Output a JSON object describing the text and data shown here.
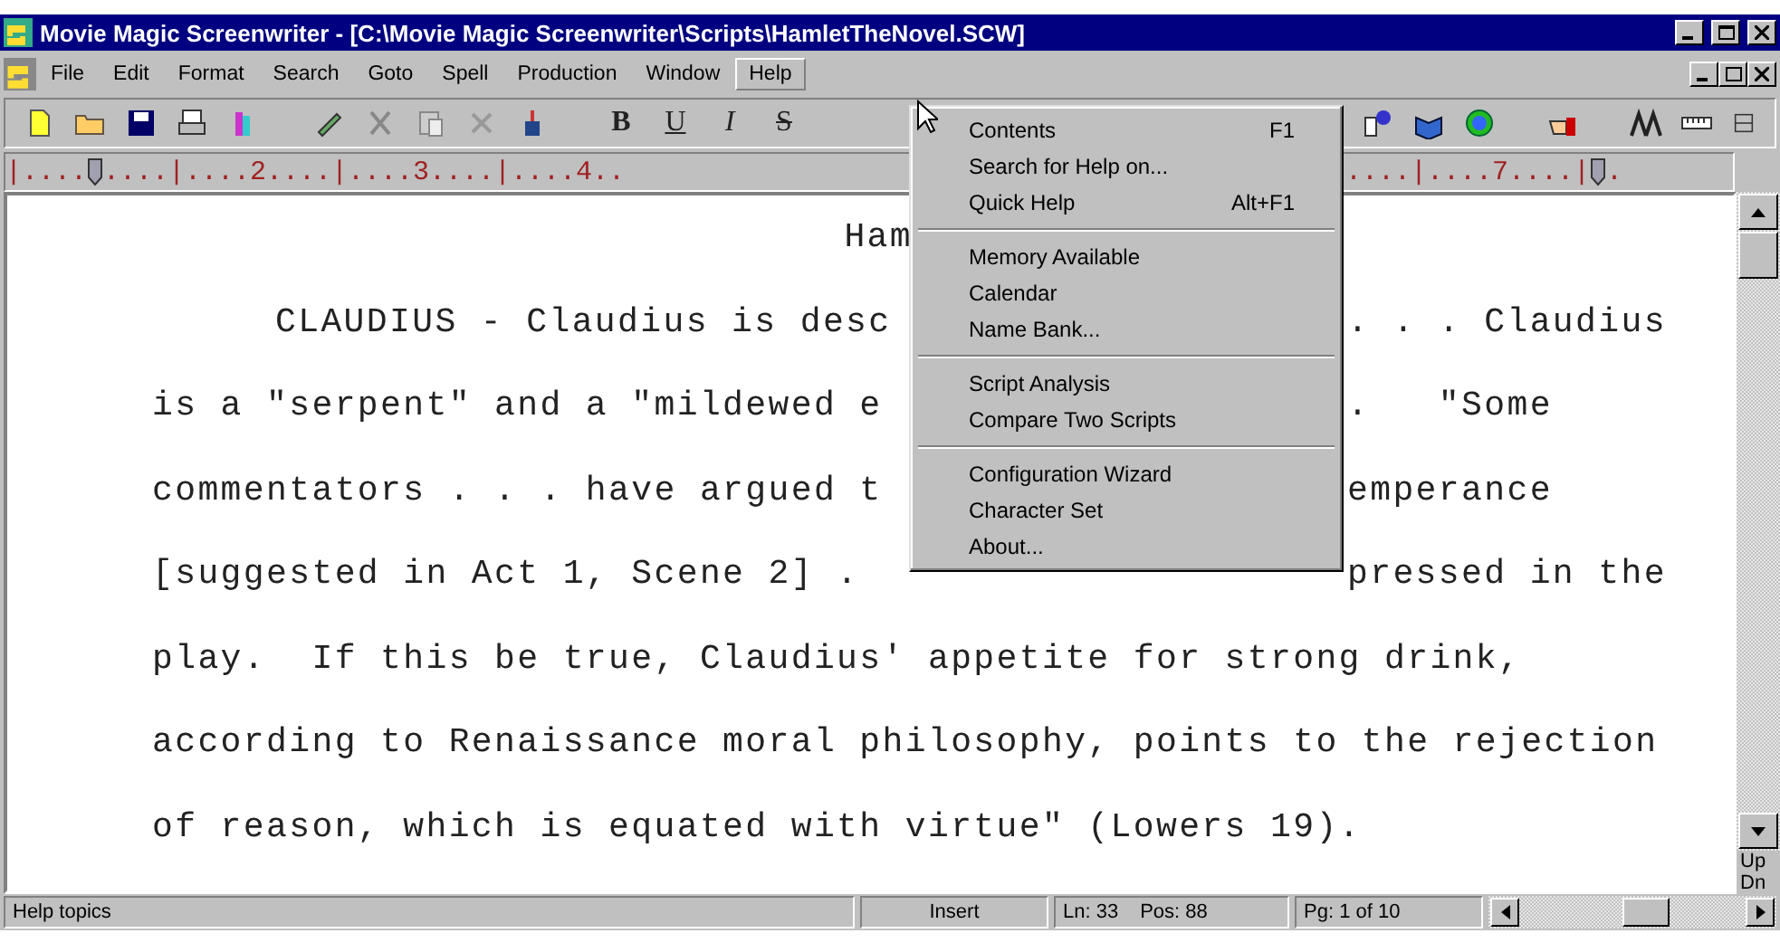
{
  "window": {
    "title": "Movie Magic Screenwriter - [C:\\Movie Magic Screenwriter\\Scripts\\HamletTheNovel.SCW]"
  },
  "menubar": [
    {
      "label": "File",
      "selected": false
    },
    {
      "label": "Edit",
      "selected": false
    },
    {
      "label": "Format",
      "selected": false
    },
    {
      "label": "Search",
      "selected": false
    },
    {
      "label": "Goto",
      "selected": false
    },
    {
      "label": "Spell",
      "selected": false
    },
    {
      "label": "Production",
      "selected": false
    },
    {
      "label": "Window",
      "selected": false
    },
    {
      "label": "Help",
      "selected": true
    }
  ],
  "format_buttons": [
    "B",
    "U",
    "I",
    "S"
  ],
  "ruler": {
    "left": [
      {
        "kind": "text",
        "text": "|...."
      },
      {
        "kind": "marker"
      },
      {
        "kind": "text",
        "text": "....|....2....|....3....|....4.."
      }
    ],
    "right": [
      {
        "kind": "text",
        "text": "....|....7....|"
      },
      {
        "kind": "marker"
      },
      {
        "kind": "text",
        "text": "."
      }
    ]
  },
  "document": {
    "lines": [
      {
        "kind": "title",
        "left": "Ham"
      },
      {
        "kind": "split_indented",
        "left": "CLAUDIUS - Claudius is desc",
        "right": ". . . Claudius"
      },
      {
        "kind": "split",
        "left": "is a \"serpent\" and a \"mildewed e",
        "right": ".   \"Some"
      },
      {
        "kind": "split",
        "left": "commentators . . . have argued t",
        "right": "emperance"
      },
      {
        "kind": "split",
        "left": "[suggested in Act 1, Scene 2] .",
        "right": "pressed in the"
      },
      {
        "kind": "full",
        "text": "play.  If this be true, Claudius' appetite for strong drink,"
      },
      {
        "kind": "full",
        "text": "according to Renaissance moral philosophy, points to the rejection"
      },
      {
        "kind": "full",
        "text": "of reason, which is equated with virtue\" (Lowers 19)."
      }
    ]
  },
  "help_menu": [
    {
      "kind": "item",
      "label": "Contents",
      "shortcut": "F1"
    },
    {
      "kind": "item",
      "label": "Search for Help on..."
    },
    {
      "kind": "item",
      "label": "Quick Help",
      "shortcut": "Alt+F1"
    },
    {
      "kind": "separator"
    },
    {
      "kind": "item",
      "label": "Memory Available"
    },
    {
      "kind": "item",
      "label": "Calendar"
    },
    {
      "kind": "item",
      "label": "Name Bank..."
    },
    {
      "kind": "separator"
    },
    {
      "kind": "item",
      "label": "Script Analysis"
    },
    {
      "kind": "item",
      "label": "Compare Two Scripts"
    },
    {
      "kind": "separator"
    },
    {
      "kind": "item",
      "label": "Configuration Wizard"
    },
    {
      "kind": "item",
      "label": "Character Set"
    },
    {
      "kind": "item",
      "label": "About..."
    }
  ],
  "scrollbar": {
    "up_label": "Up",
    "down_label": "Dn"
  },
  "status_bar": {
    "message": "Help topics",
    "mode": "Insert",
    "line": "Ln: 33",
    "pos": "Pos: 88",
    "page": "Pg: 1 of 10"
  }
}
